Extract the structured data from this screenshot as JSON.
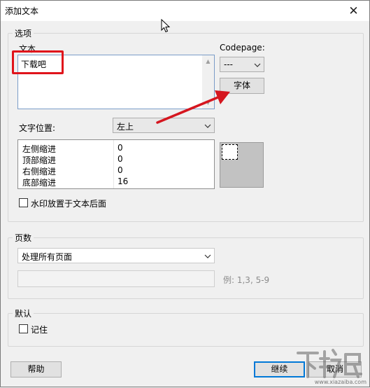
{
  "window": {
    "title": "添加文本",
    "close_glyph": "✕"
  },
  "options_group": {
    "legend": "选项",
    "text_label": "文本",
    "text_value": "下载吧",
    "codepage_label": "Codepage:",
    "codepage_value": "---",
    "font_button": "字体",
    "position_label": "文字位置:",
    "position_value": "左上",
    "margins": [
      {
        "label": "左侧缩进",
        "value": "0"
      },
      {
        "label": "顶部缩进",
        "value": "0"
      },
      {
        "label": "右侧缩进",
        "value": "0"
      },
      {
        "label": "底部缩进",
        "value": "16"
      }
    ],
    "behind_text_label": "水印放置于文本后面"
  },
  "pages_group": {
    "legend": "页数",
    "mode_value": "处理所有页面",
    "range_hint": "例: 1,3, 5-9"
  },
  "default_group": {
    "legend": "默认",
    "remember_label": "记住"
  },
  "footer": {
    "help_button": "帮助",
    "continue_button": "继续",
    "cancel_button": "取消"
  },
  "colors": {
    "highlight": "#e0141b",
    "arrow": "#d5161f",
    "focus": "#0078d7"
  }
}
